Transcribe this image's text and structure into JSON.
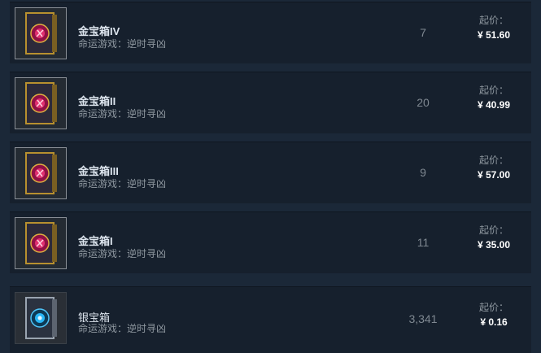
{
  "listings": [
    {
      "name": "金宝箱IV",
      "game": "命运游戏：逆时寻凶",
      "quantity": "7",
      "price_label": "起价：",
      "price": "¥ 51.60",
      "icon": "gold-chest-icon",
      "accent": "#c2185b"
    },
    {
      "name": "金宝箱II",
      "game": "命运游戏：逆时寻凶",
      "quantity": "20",
      "price_label": "起价：",
      "price": "¥ 40.99",
      "icon": "gold-chest-icon",
      "accent": "#c2185b"
    },
    {
      "name": "金宝箱III",
      "game": "命运游戏：逆时寻凶",
      "quantity": "9",
      "price_label": "起价：",
      "price": "¥ 57.00",
      "icon": "gold-chest-icon",
      "accent": "#c2185b"
    },
    {
      "name": "金宝箱I",
      "game": "命运游戏：逆时寻凶",
      "quantity": "11",
      "price_label": "起价：",
      "price": "¥ 35.00",
      "icon": "gold-chest-icon",
      "accent": "#c2185b"
    },
    {
      "name": "银宝箱",
      "game": "命运游戏：逆时寻凶",
      "quantity": "3,341",
      "price_label": "起价：",
      "price": "¥ 0.16",
      "icon": "silver-chest-icon",
      "accent": "#29b6f6"
    }
  ]
}
